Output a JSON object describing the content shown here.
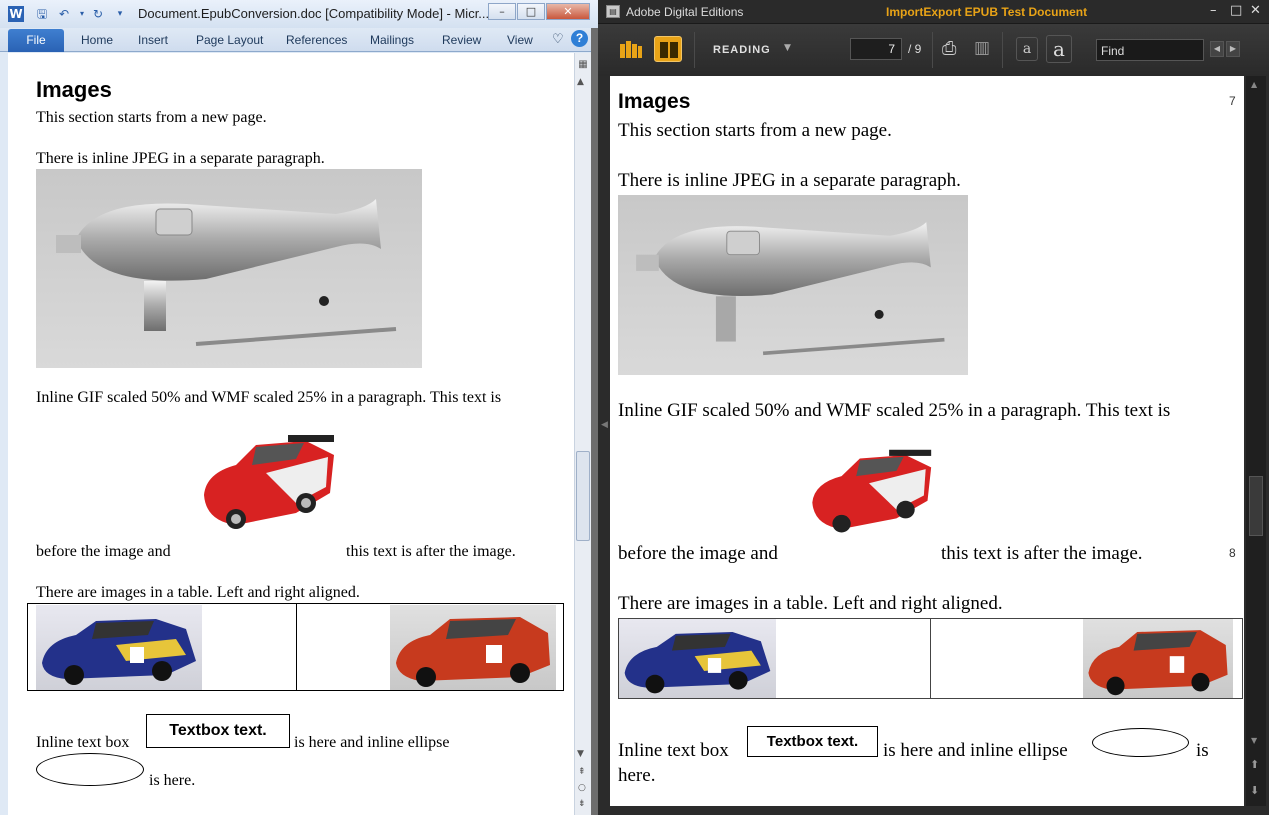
{
  "word": {
    "title": "Document.EpubConversion.doc [Compatibility Mode] - Micr...",
    "tabs": [
      "File",
      "Home",
      "Insert",
      "Page Layout",
      "References",
      "Mailings",
      "Review",
      "View"
    ],
    "doc": {
      "heading": "Images",
      "p1": "This section starts from a new page.",
      "p2": "There is inline JPEG in a separate paragraph.",
      "p3": "Inline GIF scaled 50% and WMF scaled 25% in a paragraph. This text is",
      "p4a": "before the image and",
      "p4b": "this text is after the image.",
      "p5": "There are images in a table. Left and right aligned.",
      "p6a": "Inline text box",
      "textbox": "Textbox text.",
      "p6b": "is here and inline ellipse",
      "p7": "is here."
    }
  },
  "ade": {
    "app_name": "Adobe Digital Editions",
    "doc_title": "ImportExport EPUB Test Document",
    "mode": "READING",
    "page_current": "7",
    "page_total": "/ 9",
    "find_placeholder": "Find",
    "font_small": "a",
    "font_large": "a",
    "content": {
      "heading": "Images",
      "page_num_1": "7",
      "page_num_2": "8",
      "p1": "This section starts from a new page.",
      "p2": "There is inline JPEG in a separate paragraph.",
      "p3": "Inline GIF scaled 50% and WMF scaled 25% in a paragraph. This text is",
      "p4a": "before the image and",
      "p4b": "this text is after the image.",
      "p5": "There are images in a table. Left and right aligned.",
      "p6a": "Inline text box",
      "textbox": "Textbox text.",
      "p6b": "is here and inline ellipse",
      "p6c": "is",
      "p7": "here."
    }
  },
  "colors": {
    "ade_accent": "#e8a317",
    "word_blue": "#2a62b4"
  }
}
